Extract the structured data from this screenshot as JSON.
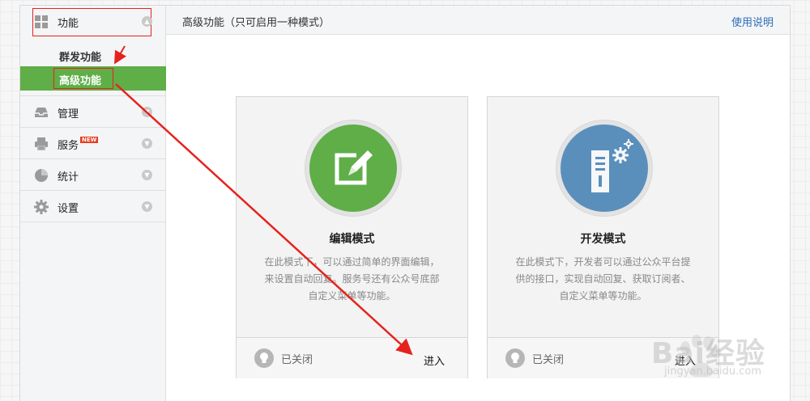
{
  "sidebar": {
    "groups": [
      {
        "label": "功能",
        "icon": "grid-icon"
      },
      {
        "label": "管理",
        "icon": "inbox-icon"
      },
      {
        "label": "服务",
        "icon": "printer-icon",
        "badge": "NEW"
      },
      {
        "label": "统计",
        "icon": "pie-chart-icon"
      },
      {
        "label": "设置",
        "icon": "gear-icon"
      }
    ],
    "function_subitems": [
      {
        "label": "群发功能"
      },
      {
        "label": "高级功能",
        "active": true
      }
    ]
  },
  "header": {
    "title": "高级功能（只可启用一种模式）",
    "help_link": "使用说明"
  },
  "cards": [
    {
      "title": "编辑模式",
      "icon": "edit-icon",
      "icon_color": "#5fae48",
      "desc_lines": [
        "在此模式下，可以通过简单的界面编辑，",
        "来设置自动回复。服务号还有公众号底部",
        "自定义菜单等功能。"
      ],
      "status": "已关闭",
      "enter": "进入"
    },
    {
      "title": "开发模式",
      "icon": "server-gear-icon",
      "icon_color": "#5b8fbb",
      "desc_lines": [
        "在此模式下，开发者可以通过公众平台提",
        "供的接口，实现自动回复、获取订阅者、",
        "自定义菜单等功能。"
      ],
      "status": "已关闭",
      "enter": "进入"
    }
  ],
  "watermark": {
    "brand": "Bai经验",
    "url": "jingyan.baidu.com"
  },
  "colors": {
    "accent_green": "#5fae48",
    "link_blue": "#2b6db8",
    "annotation_red": "#e5231c"
  }
}
